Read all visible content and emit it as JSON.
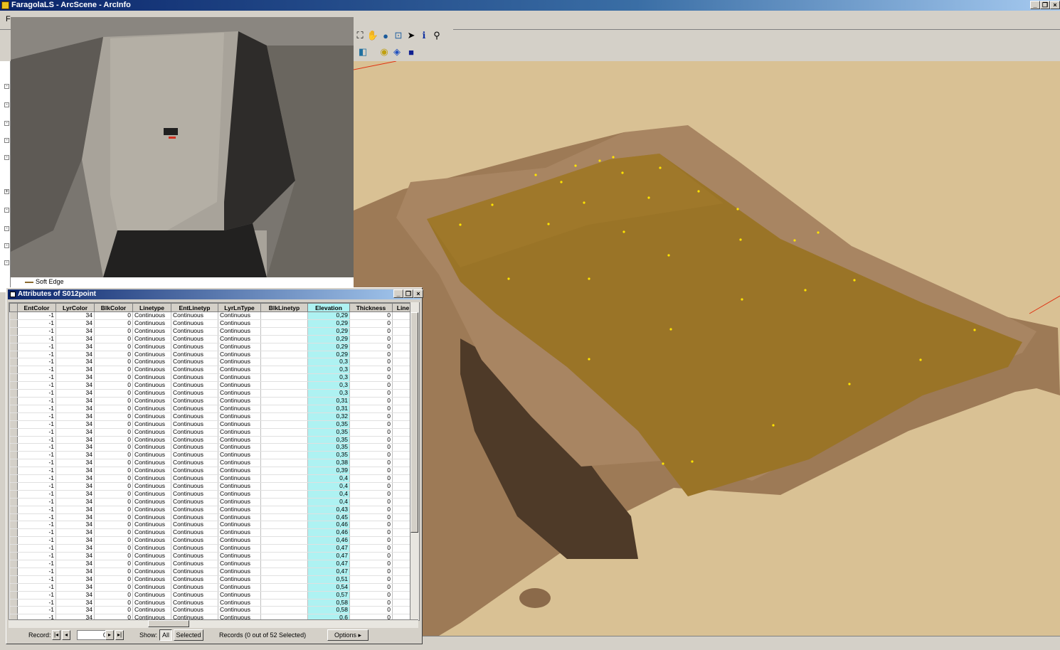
{
  "window": {
    "title": "FaragolaLS - ArcScene - ArcInfo"
  },
  "menubar": {
    "first_item": "F"
  },
  "toolbar": {
    "tools": [
      "full-extent-icon",
      "pan-hand-icon",
      "globe-icon",
      "zoom-to-icon",
      "select-arrow-icon",
      "identify-icon",
      "find-binoculars-icon"
    ],
    "second_row": [
      "layer-icon",
      "navigate-icon",
      "shapes-icon",
      "globe-small-icon",
      "cube-icon"
    ]
  },
  "legend": {
    "label": "Soft Edge"
  },
  "attributes": {
    "title": "Attributes of S012point",
    "columns": [
      "EntColor",
      "LyrColor",
      "BlkColor",
      "Linetype",
      "EntLinetyp",
      "LyrLnType",
      "BlkLinetyp",
      "Elevation",
      "Thickness",
      "Line"
    ],
    "row_template": {
      "EntColor": "-1",
      "LyrColor": "34",
      "BlkColor": "0",
      "Linetype": "Continuous",
      "EntLinetyp": "Continuous",
      "LyrLnType": "Continuous",
      "BlkLinetyp": "",
      "Thickness": "0"
    },
    "elevations": [
      "0,29",
      "0,29",
      "0,29",
      "0,29",
      "0,29",
      "0,29",
      "0,3",
      "0,3",
      "0,3",
      "0,3",
      "0,3",
      "0,31",
      "0,31",
      "0,32",
      "0,35",
      "0,35",
      "0,35",
      "0,35",
      "0,35",
      "0,38",
      "0,39",
      "0,4",
      "0,4",
      "0,4",
      "0,4",
      "0,43",
      "0,45",
      "0,46",
      "0,46",
      "0,46",
      "0,47",
      "0,47",
      "0,47",
      "0,47",
      "0,51",
      "0,54",
      "0,57",
      "0,58",
      "0,58",
      "0,6"
    ],
    "status": {
      "record_label": "Record:",
      "record_value": "0",
      "show_label": "Show:",
      "all_label": "All",
      "selected_label": "Selected",
      "records_text": "Records (0 out of 52 Selected)",
      "options_label": "Options"
    }
  },
  "colors": {
    "scene_bg": "#d9c194",
    "surface": "#9a7427",
    "elevation_column": "#aef2f2",
    "point": "#ffe400",
    "axis": "#e03010"
  }
}
